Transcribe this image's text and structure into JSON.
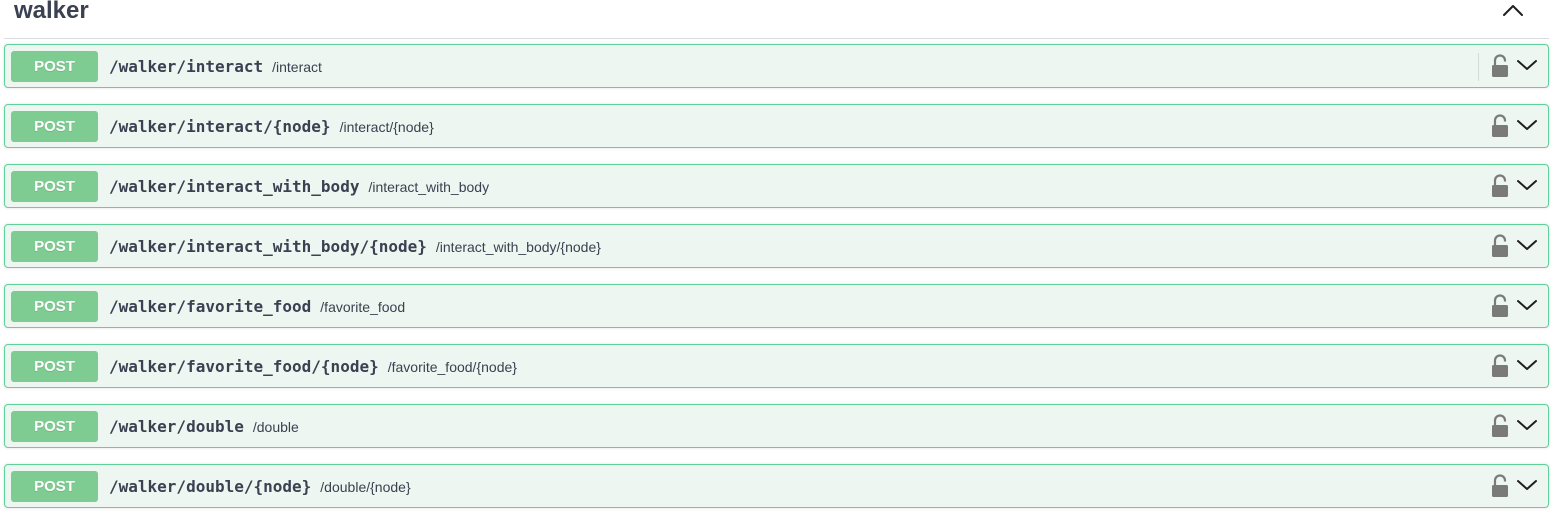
{
  "tag": {
    "title": "walker",
    "toggle_icon": "chevron-up-icon"
  },
  "colors": {
    "post_badge": "#7fcc93",
    "row_background": "#edf6f0",
    "row_border": "#5fd19b",
    "text": "#3b4151",
    "icon": "#7a7a7a"
  },
  "operations": [
    {
      "method": "POST",
      "path": "/walker/interact",
      "summary": "/interact",
      "lock_icon": "unlocked-padlock-icon",
      "expand_icon": "chevron-down-icon"
    },
    {
      "method": "POST",
      "path": "/walker/interact/{node}",
      "summary": "/interact/{node}",
      "lock_icon": "unlocked-padlock-icon",
      "expand_icon": "chevron-down-icon"
    },
    {
      "method": "POST",
      "path": "/walker/interact_with_body",
      "summary": "/interact_with_body",
      "lock_icon": "unlocked-padlock-icon",
      "expand_icon": "chevron-down-icon"
    },
    {
      "method": "POST",
      "path": "/walker/interact_with_body/{node}",
      "summary": "/interact_with_body/{node}",
      "lock_icon": "unlocked-padlock-icon",
      "expand_icon": "chevron-down-icon"
    },
    {
      "method": "POST",
      "path": "/walker/favorite_food",
      "summary": "/favorite_food",
      "lock_icon": "unlocked-padlock-icon",
      "expand_icon": "chevron-down-icon"
    },
    {
      "method": "POST",
      "path": "/walker/favorite_food/{node}",
      "summary": "/favorite_food/{node}",
      "lock_icon": "unlocked-padlock-icon",
      "expand_icon": "chevron-down-icon"
    },
    {
      "method": "POST",
      "path": "/walker/double",
      "summary": "/double",
      "lock_icon": "unlocked-padlock-icon",
      "expand_icon": "chevron-down-icon"
    },
    {
      "method": "POST",
      "path": "/walker/double/{node}",
      "summary": "/double/{node}",
      "lock_icon": "unlocked-padlock-icon",
      "expand_icon": "chevron-down-icon"
    }
  ]
}
